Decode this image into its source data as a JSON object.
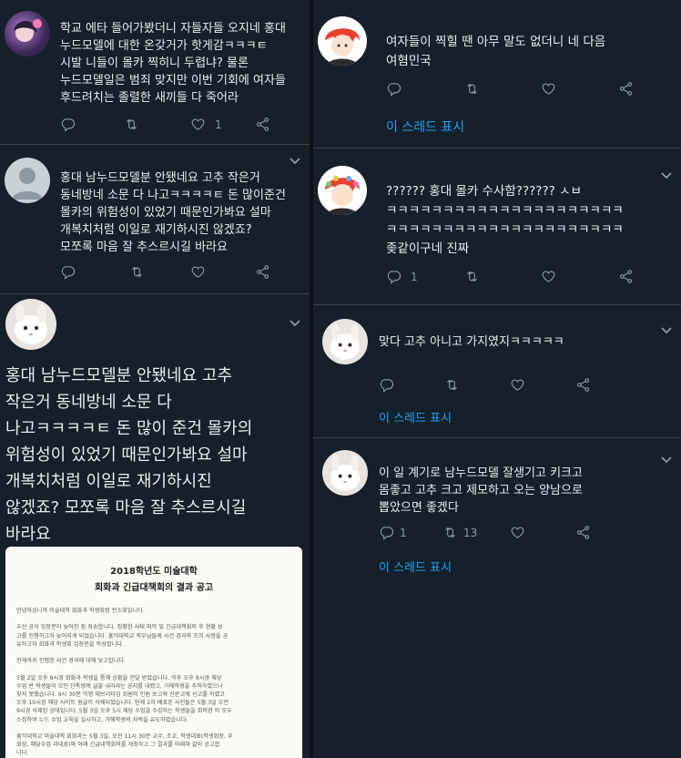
{
  "left": {
    "tweets": [
      {
        "text": "학교 에타 들어가봤더니 자들자들 오지네 홍대\n누드모델에 대한 온갖거가 핫게감ㅋㅋㅋㅌ\n시발 니들이 몰카 찍히니 두렵냐? 물론\n누드모델일은 범죄 맞지만 이번 기회에 여자들\n후드려치는 졸렬한 새끼들 다 죽어라",
        "like_count": "1"
      },
      {
        "text": "홍대 남누드모델분 안됐네요 고추 작은거\n동네방네 소문 다 나고ㅋㅋㅋㅋㅌ 돈 많이준건\n몰카의 위험성이 있었기 때문인가봐요 설마\n개복치처럼 이일로 재기하시진 않겠죠?\n모쪼록 마음 잘 추스르시길 바라요"
      },
      {
        "text": "홍대 남누드모델분 안됐네요 고추\n작은거 동네방네 소문 다\n나고ㅋㅋㅋㅋㅌ 돈 많이 준건 몰카의\n위험성이 있었기 때문인가봐요 설마\n개복치처럼 이일로 재기하시진\n않겠죠? 모쪼록 마음 잘 추스르시길\n바라요",
        "notice": {
          "title1": "2018학년도 미술대학",
          "title2": "회화과 긴급대책회의 결과 공고",
          "body": "안녕하십니까 미술대학 회화과 학생회장 전소희입니다.\n\n우선 공식 입장문이 늦어진 점 죄송합니다. 정확한 사태 파악 및 긴급대책회의 후 현황 보\n고를 진행하고자 늦어지게 되었습니다. 홍익대학교 학우님들께 사건 경과와 조치 사항을 공\n유하고자 회화과 학생회 입장문을 작성합니다.\n\n현재까지 진행된 사건 경과에 대해 보고합니다.\n\n5월 2일 오후 8시경 회화과 학생을 통해 상황을 전달 받았습니다. 이후 오후 9시경 해당\n수업 반 학생들이 모인 단톡방에 글을 내리라는 공지를 내렸고, 가해학생을 추적하였으나\n찾지 못했습니다. 9시 30분 익명 에브리타임 회원이 민원 보고와 신문고에 신고를 하였고\n오후 10시경 해당 사이트 원글이 삭제되었습니다. 현재 2차 배포된 사진들은 5월 3일 오전\n9시경 삭제된 상태입니다. 5월 3일 오후 5시 해당 수업을 수강하는 학생들을 회의한 이 모두\n소집하여 누드 수업 교육을 실시하고, 가해학생의 자백을 유도하였습니다.\n\n홍익대학교 미술대학 회화과는 5월 3일, 오전 11시 30분 교수, 조교, 학생대표(학생회장, 부\n회장, 해당수업 과대표)와 아래 긴급대책회의를 개최하고 그 결과를 아래와 같이 공고합\n니다."
        }
      }
    ]
  },
  "right": {
    "tweets": [
      {
        "text": "여자들이 찍힐 땐 아무 말도 없더니 네 다음\n여혐민국",
        "thread_label": "이 스레드 표시"
      },
      {
        "text": "?????? 홍대 몰카 수사함?????? ㅅㅂ\nㅋㅋㅋㅋㅋㅋㅋㅋㅋㅋㅋㅋㅋㅋㅋㅋㅋㅋㅋㅋㅋ\nㅋㅋㅋㅋㅋㅋㅋㅋㅋㅋㅋㅋㅋㅋㅋㅋㅋㅋㅋㅋㅋ\n좆같이구네 진짜",
        "reply_count": "1"
      },
      {
        "text": "맞다 고추 아니고 가지였지ㅋㅋㅋㅋㅋ",
        "thread_label": "이 스레드 표시"
      },
      {
        "text": "이 일 계기로 남누드모델 잘생기고 키크고\n몸좋고 고추 크고 제모하고 오는 양남으로\n뽑았으면 좋겠다",
        "reply_count": "1",
        "retweet_count": "13",
        "thread_label": "이 스레드 표시"
      }
    ]
  },
  "colors": {
    "background": "#15202b",
    "text": "#e7ecf0",
    "muted": "#8899a6",
    "link": "#1da1f2",
    "divider": "#38444d"
  }
}
